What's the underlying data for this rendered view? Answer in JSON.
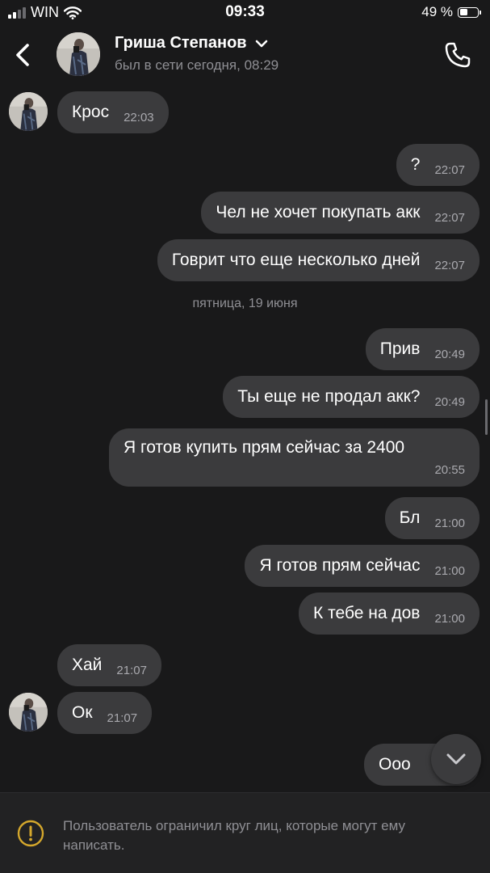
{
  "status_bar": {
    "carrier": "WIN",
    "time": "09:33",
    "battery_text": "49 %",
    "battery_level": 0.49
  },
  "header": {
    "contact_name": "Гриша Степанов",
    "contact_status": "был в сети сегодня, 08:29"
  },
  "messages": [
    {
      "text": "Крос",
      "time": "22:03",
      "from": "contact"
    },
    {
      "text": "?",
      "time": "22:07",
      "from": "me"
    },
    {
      "text": "Чел не хочет покупать акк",
      "time": "22:07",
      "from": "me"
    },
    {
      "text": "Говрит что еще несколько дней",
      "time": "22:07",
      "from": "me"
    },
    {
      "text": "Прив",
      "time": "20:49",
      "from": "me"
    },
    {
      "text": "Ты еще не продал акк?",
      "time": "20:49",
      "from": "me"
    },
    {
      "text": "Я готов купить прям сейчас за 2400",
      "time": "20:55",
      "from": "me"
    },
    {
      "text": "Бл",
      "time": "21:00",
      "from": "me"
    },
    {
      "text": "Я готов прям сейчас",
      "time": "21:00",
      "from": "me"
    },
    {
      "text": "К тебе на дов",
      "time": "21:00",
      "from": "me"
    },
    {
      "text": "Хай",
      "time": "21:07",
      "from": "contact"
    },
    {
      "text": "Ок",
      "time": "21:07",
      "from": "contact"
    },
    {
      "text": "Ооо",
      "time": "",
      "from": "me"
    }
  ],
  "date_separator": "пятница, 19 июня",
  "restriction_notice": "Пользователь ограничил круг лиц, которые могут ему написать.",
  "colors": {
    "background": "#19191a",
    "bubble": "#3b3b3d",
    "secondary_text": "#8f8f94"
  }
}
